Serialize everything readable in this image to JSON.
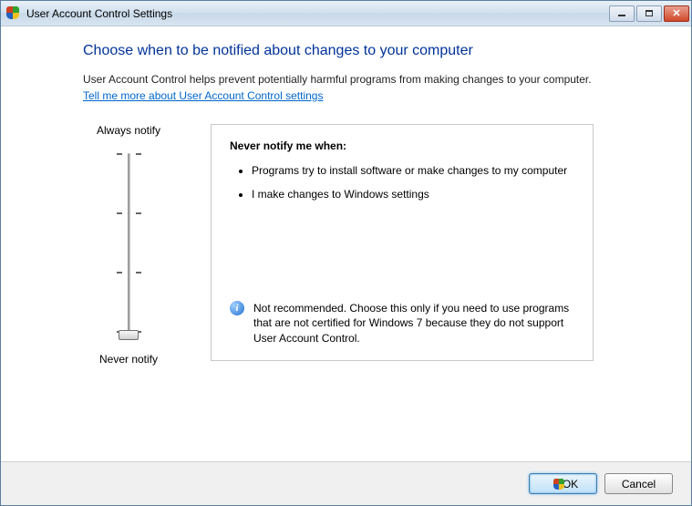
{
  "window": {
    "title": "User Account Control Settings",
    "buttons": {
      "min": "Minimize",
      "max": "Maximize",
      "close": "Close"
    }
  },
  "heading": "Choose when to be notified about changes to your computer",
  "subtext": "User Account Control helps prevent potentially harmful programs from making changes to your computer.",
  "help_link": "Tell me more about User Account Control settings",
  "slider": {
    "top_label": "Always notify",
    "bottom_label": "Never notify",
    "levels": 4,
    "current_level": 0
  },
  "detail": {
    "title": "Never notify me when:",
    "bullets": [
      "Programs try to install software or make changes to my computer",
      "I make changes to Windows settings"
    ],
    "recommendation": "Not recommended. Choose this only if you need to use programs that are not certified for Windows 7 because they do not support User Account Control."
  },
  "footer": {
    "ok": "OK",
    "cancel": "Cancel"
  }
}
